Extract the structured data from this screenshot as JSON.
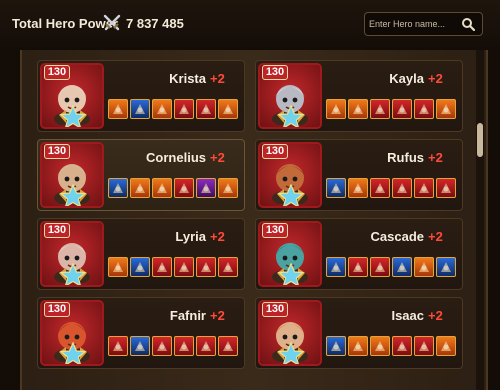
{
  "header": {
    "power_label": "Total Hero Power",
    "power_icon": "crossed-swords-icon",
    "power_value": "7 837 485"
  },
  "search": {
    "placeholder": "Enter Hero name...",
    "value": "",
    "icon": "search-icon"
  },
  "colors": {
    "level_badge": "#bd2429",
    "plus_text": "#ff4a3a",
    "card_bg": "#2a1d12",
    "item_border": "#e0a63a"
  },
  "heroes": [
    {
      "name": "Krista",
      "plus": "+2",
      "level": "130",
      "selected": false,
      "skin": "#e8c7b0",
      "hair": "#d8d8d8",
      "items": [
        "orange",
        "blue",
        "orange",
        "red",
        "red",
        "orange"
      ]
    },
    {
      "name": "Kayla",
      "plus": "+2",
      "level": "130",
      "selected": false,
      "skin": "#b9b9c4",
      "hair": "#f0f0f0",
      "items": [
        "orange",
        "orange",
        "red",
        "red",
        "red",
        "orange"
      ]
    },
    {
      "name": "Cornelius",
      "plus": "+2",
      "level": "130",
      "selected": true,
      "skin": "#d8b08c",
      "hair": "#c9c9c9",
      "items": [
        "blue",
        "orange",
        "orange",
        "red",
        "purple",
        "orange"
      ]
    },
    {
      "name": "Rufus",
      "plus": "+2",
      "level": "130",
      "selected": false,
      "skin": "#c26a3a",
      "hair": "#8a2c18",
      "items": [
        "blue",
        "orange",
        "red",
        "red",
        "red",
        "red"
      ]
    },
    {
      "name": "Lyria",
      "plus": "+2",
      "level": "130",
      "selected": false,
      "skin": "#dcb4a8",
      "hair": "#e7e4ef",
      "items": [
        "orange",
        "blue",
        "red",
        "red",
        "red",
        "red"
      ]
    },
    {
      "name": "Cascade",
      "plus": "+2",
      "level": "130",
      "selected": false,
      "skin": "#4aa3a0",
      "hair": "#2f6b6e",
      "items": [
        "blue",
        "red",
        "red",
        "blue",
        "orange",
        "blue"
      ]
    },
    {
      "name": "Fafnir",
      "plus": "+2",
      "level": "130",
      "selected": false,
      "skin": "#d9552e",
      "hair": "#7a2a12",
      "items": [
        "red",
        "blue",
        "red",
        "red",
        "red",
        "red"
      ]
    },
    {
      "name": "Isaac",
      "plus": "+2",
      "level": "130",
      "selected": false,
      "skin": "#e0b08a",
      "hair": "#c47b2b",
      "items": [
        "blue",
        "orange",
        "orange",
        "red",
        "red",
        "orange"
      ]
    }
  ]
}
